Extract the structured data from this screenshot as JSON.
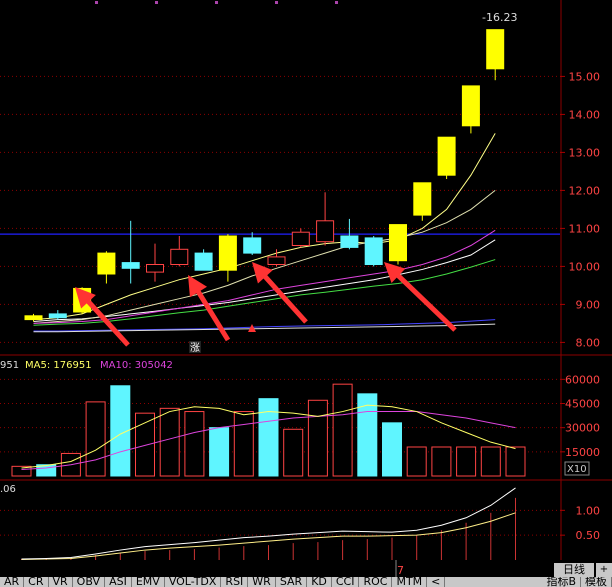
{
  "chart_data": [
    {
      "type": "candlestick",
      "title": "",
      "ylim": [
        7.8,
        16.8
      ],
      "yticks": [
        "8.00",
        "9.00",
        "10.00",
        "11.00",
        "12.00",
        "13.00",
        "14.00",
        "15.00"
      ],
      "price_label": "16.23",
      "reference_price": 10.85,
      "limit_marker_label": "涨",
      "candles": [
        {
          "o": 8.6,
          "h": 8.75,
          "l": 8.55,
          "c": 8.7,
          "color": "#ffff00"
        },
        {
          "o": 8.65,
          "h": 8.85,
          "l": 8.6,
          "c": 8.75,
          "color": "#5ff5ff"
        },
        {
          "o": 8.8,
          "h": 9.45,
          "l": 8.75,
          "c": 9.42,
          "color": "#ffff00"
        },
        {
          "o": 9.8,
          "h": 10.4,
          "l": 9.55,
          "c": 10.35,
          "color": "#ffff00"
        },
        {
          "o": 10.1,
          "h": 11.2,
          "l": 9.55,
          "c": 9.95,
          "color": "#5ff5ff"
        },
        {
          "o": 9.85,
          "h": 10.6,
          "l": 9.6,
          "c": 10.05,
          "color": "#ff4444"
        },
        {
          "o": 10.05,
          "h": 10.8,
          "l": 10.0,
          "c": 10.45,
          "color": "#ff4444"
        },
        {
          "o": 10.35,
          "h": 10.45,
          "l": 9.9,
          "c": 9.9,
          "color": "#5ff5ff"
        },
        {
          "o": 9.9,
          "h": 10.85,
          "l": 9.6,
          "c": 10.8,
          "color": "#ffff00"
        },
        {
          "o": 10.75,
          "h": 10.9,
          "l": 10.3,
          "c": 10.35,
          "color": "#5ff5ff"
        },
        {
          "o": 10.05,
          "h": 10.45,
          "l": 10.0,
          "c": 10.25,
          "color": "#ff4444"
        },
        {
          "o": 10.55,
          "h": 11.0,
          "l": 10.5,
          "c": 10.9,
          "color": "#ff4444"
        },
        {
          "o": 10.65,
          "h": 11.95,
          "l": 10.55,
          "c": 11.2,
          "color": "#ff4444"
        },
        {
          "o": 10.8,
          "h": 11.25,
          "l": 10.45,
          "c": 10.5,
          "color": "#5ff5ff"
        },
        {
          "o": 10.75,
          "h": 10.8,
          "l": 10.0,
          "c": 10.05,
          "color": "#5ff5ff"
        },
        {
          "o": 10.15,
          "h": 11.1,
          "l": 10.05,
          "c": 11.1,
          "color": "#ffff00"
        },
        {
          "o": 11.35,
          "h": 12.2,
          "l": 11.2,
          "c": 12.2,
          "color": "#ffff00"
        },
        {
          "o": 12.4,
          "h": 13.4,
          "l": 12.3,
          "c": 13.4,
          "color": "#ffff00"
        },
        {
          "o": 13.7,
          "h": 14.75,
          "l": 13.5,
          "c": 14.75,
          "color": "#ffff00"
        },
        {
          "o": 15.2,
          "h": 16.23,
          "l": 14.9,
          "c": 16.23,
          "color": "#ffff00"
        }
      ],
      "ma_lines": [
        {
          "color": "#ffffff",
          "values": [
            8.55,
            8.6,
            8.62,
            8.68,
            8.75,
            8.82,
            8.9,
            8.97,
            9.05,
            9.15,
            9.25,
            9.35,
            9.45,
            9.55,
            9.65,
            9.78,
            9.92,
            10.1,
            10.3,
            10.7
          ]
        },
        {
          "color": "#ffff88",
          "values": [
            8.6,
            8.65,
            8.75,
            9.0,
            9.25,
            9.45,
            9.65,
            9.8,
            9.95,
            10.15,
            10.35,
            10.5,
            10.6,
            10.65,
            10.6,
            10.7,
            11.0,
            11.5,
            12.4,
            13.5
          ]
        },
        {
          "color": "#e0e0b0",
          "values": [
            8.5,
            8.55,
            8.6,
            8.7,
            8.85,
            9.0,
            9.15,
            9.3,
            9.5,
            9.75,
            9.95,
            10.15,
            10.35,
            10.55,
            10.65,
            10.75,
            10.9,
            11.15,
            11.5,
            12.0
          ]
        },
        {
          "color": "#dd44dd",
          "values": [
            8.5,
            8.52,
            8.55,
            8.6,
            8.7,
            8.8,
            8.9,
            9.0,
            9.1,
            9.25,
            9.4,
            9.5,
            9.6,
            9.7,
            9.8,
            9.9,
            10.05,
            10.25,
            10.55,
            10.95
          ]
        },
        {
          "color": "#44dd44",
          "values": [
            8.45,
            8.48,
            8.5,
            8.55,
            8.62,
            8.7,
            8.78,
            8.85,
            8.95,
            9.05,
            9.15,
            9.25,
            9.32,
            9.4,
            9.48,
            9.55,
            9.65,
            9.8,
            9.98,
            10.18
          ]
        },
        {
          "color": "#4444ff",
          "values": [
            8.3,
            8.3,
            8.31,
            8.32,
            8.33,
            8.34,
            8.35,
            8.36,
            8.38,
            8.4,
            8.42,
            8.43,
            8.44,
            8.45,
            8.46,
            8.48,
            8.5,
            8.52,
            8.56,
            8.6
          ]
        },
        {
          "color": "#dddddd",
          "values": [
            8.28,
            8.28,
            8.29,
            8.3,
            8.31,
            8.32,
            8.33,
            8.34,
            8.35,
            8.36,
            8.37,
            8.38,
            8.39,
            8.4,
            8.41,
            8.42,
            8.43,
            8.44,
            8.46,
            8.48
          ]
        }
      ]
    },
    {
      "type": "bar",
      "ylim": [
        0,
        72000
      ],
      "yticks": [
        "15000",
        "30000",
        "45000",
        "60000"
      ],
      "unit_label": "X10",
      "legend_prefix": "951",
      "legend_ma5": "MA5: 176951",
      "legend_ma10": "MA10: 305042",
      "values": [
        6000,
        7000,
        14000,
        46000,
        56000,
        39000,
        42000,
        40000,
        30000,
        40000,
        48000,
        29000,
        47000,
        57000,
        51000,
        33000,
        18000,
        18000,
        18000,
        18000,
        18000
      ],
      "hollow": [
        false,
        true,
        false,
        false,
        true,
        false,
        false,
        false,
        true,
        false,
        true,
        false,
        false,
        false,
        true,
        true,
        false,
        false,
        false,
        false,
        false
      ],
      "ma5": [
        5000,
        6500,
        9000,
        16000,
        26000,
        33000,
        40000,
        43000,
        42000,
        38000,
        40000,
        39000,
        37000,
        40000,
        44000,
        43000,
        40000,
        33000,
        27000,
        21000,
        17000
      ],
      "ma10": [
        4000,
        5000,
        7000,
        10000,
        15000,
        19000,
        23000,
        27000,
        30000,
        32000,
        34000,
        36000,
        37000,
        38000,
        40000,
        40000,
        40000,
        38000,
        36000,
        33000,
        30000
      ]
    },
    {
      "type": "line",
      "ylim": [
        0,
        1.55
      ],
      "yticks": [
        "0.50",
        "1.00"
      ],
      "legend_prefix": ".06",
      "marker": "7",
      "line1": [
        0.02,
        0.03,
        0.05,
        0.12,
        0.2,
        0.27,
        0.31,
        0.35,
        0.4,
        0.45,
        0.48,
        0.52,
        0.55,
        0.58,
        0.57,
        0.56,
        0.6,
        0.7,
        0.85,
        1.1,
        1.45
      ],
      "line2": [
        0.01,
        0.02,
        0.03,
        0.08,
        0.14,
        0.2,
        0.24,
        0.27,
        0.3,
        0.34,
        0.38,
        0.42,
        0.45,
        0.48,
        0.48,
        0.49,
        0.5,
        0.55,
        0.65,
        0.78,
        0.95
      ],
      "bars": [
        0.02,
        0.03,
        0.05,
        0.1,
        0.15,
        0.18,
        0.2,
        0.22,
        0.25,
        0.28,
        0.3,
        0.34,
        0.36,
        0.4,
        0.42,
        0.45,
        0.5,
        0.6,
        0.75,
        0.95,
        1.25
      ]
    }
  ],
  "tabs": [
    "AR",
    "CR",
    "VR",
    "OBV",
    "ASI",
    "EMV",
    "VOL-TDX",
    "RSI",
    "WR",
    "SAR",
    "KD",
    "CCI",
    "ROC",
    "MTM",
    "<"
  ],
  "right_tabs": [
    "指标B",
    "模板"
  ],
  "period_button": "日线",
  "nav_button": "+",
  "colors": {
    "up": "#ff4444",
    "down": "#5ff5ff",
    "yellow": "#ffff00",
    "grid": "#8b0000",
    "reference": "#2020ff",
    "arrow": "#ff3333",
    "axis_text": "#ff4444"
  }
}
